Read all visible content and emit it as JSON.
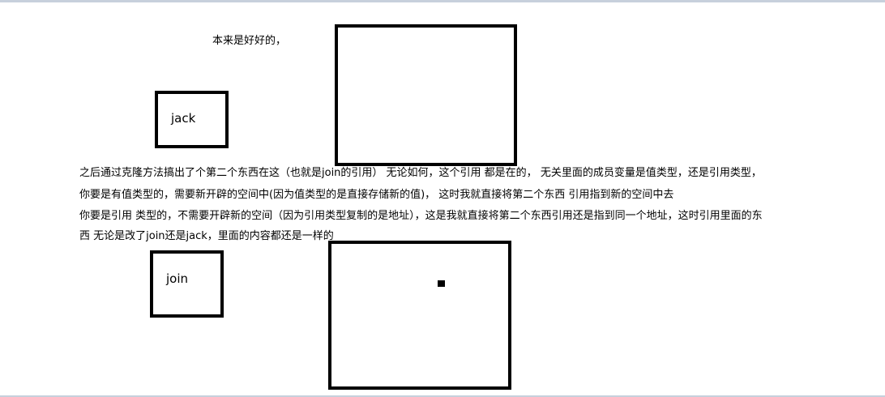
{
  "canvas": {
    "background": "#ffffff",
    "stroke_color": "#000000",
    "frame_color": "#c7d0dc"
  },
  "text": {
    "intro": "本来是好好的，",
    "line1": "之后通过克隆方法搞出了个第二个东西在这（也就是join的引用） 无论如何，这个引用 都是在的， 无关里面的成员变量是值类型，还是引用类型，",
    "line2": "你要是有值类型的，需要新开辟的空间中(因为值类型的是直接存储新的值)， 这时我就直接将第二个东西 引用指到新的空间中去",
    "line3": "你要是引用 类型的，不需要开辟新的空间（因为引用类型复制的是地址），这是我就直接将第二个东西引用还是指到同一个地址，这时引用里面的东",
    "line4": "西 无论是改了join还是jack，里面的内容都还是一样的"
  },
  "boxes": {
    "jack_label": "jack",
    "join_label": "join"
  }
}
